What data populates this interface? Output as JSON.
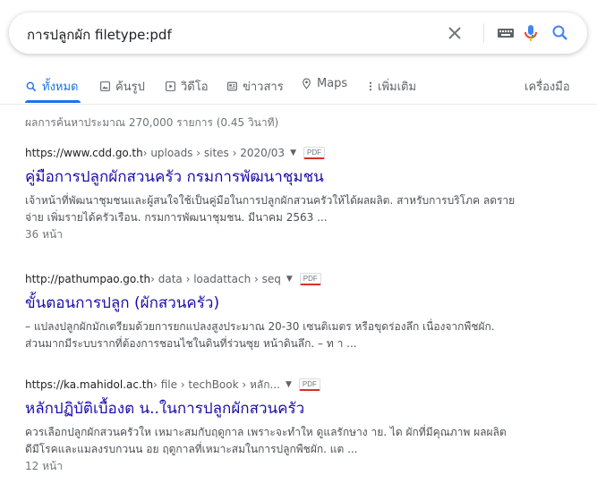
{
  "search": {
    "query": "การปลูกผัก filetype:pdf"
  },
  "icons": {
    "clear": "close-icon",
    "keyboard": "keyboard-icon",
    "mic": "microphone-icon",
    "search": "search-icon"
  },
  "colors": {
    "accent": "#1a73e8",
    "link": "#1a0dab",
    "pdf_underline": "#d93025"
  },
  "tabs": [
    {
      "label": "ทั้งหมด",
      "icon": "search-icon",
      "active": true
    },
    {
      "label": "ค้นรูป",
      "icon": "image-icon"
    },
    {
      "label": "วิดีโอ",
      "icon": "video-icon"
    },
    {
      "label": "ข่าวสาร",
      "icon": "news-icon"
    },
    {
      "label": "Maps",
      "icon": "map-pin-icon"
    },
    {
      "label": "เพิ่มเติม",
      "icon": "more-vert-icon"
    }
  ],
  "tools_label": "เครื่องมือ",
  "stats": "ผลการค้นหาประมาณ 270,000 รายการ (0.45 วินาที)",
  "results": [
    {
      "url": "https://www.cdd.go.th",
      "breadcrumb": " › uploads › sites › 2020/03",
      "badge": "PDF",
      "title": "คู่มือการปลูกผักสวนครัว กรมการพัฒนาชุมชน",
      "snippet_line1": "เจ้าหน้าที่พัฒนาชุมชนและผู้สนใจใช้เป็นคู่มือในการปลูกผักสวนครัวให้ได้ผลผลิต. สาหรับการบริโภค ลดราย",
      "snippet_line2": "จ่าย เพิ่มรายได้ครัวเรือน. กรมการพัฒนาชุมชน. มีนาคม 2563 ...",
      "pages": "36 หน้า"
    },
    {
      "url": "http://pathumpao.go.th",
      "breadcrumb": " › data › loadattach › seq",
      "badge": "PDF",
      "title": "ขั้นตอนการปลูก (ผักสวนครัว)",
      "snippet_line1": "– แปลงปลูกผักมักเตรียมด้วยการยกแปลงสูงประมาณ 20-30 เซนติเมตร หรือขุดร่องลึก เนื่องจากพืชผัก.",
      "snippet_line2": "ส่วนมากมีระบบรากที่ต้องการชอนไชในดินที่ร่วนซุย หน้าดินลึก. – ท า ...",
      "pages": ""
    },
    {
      "url": "https://ka.mahidol.ac.th",
      "breadcrumb": " › file › techBook › หลัก...",
      "badge": "PDF",
      "title": "หลักปฏิบัติเบื้องต น..ในการปลูกผักสวนครัว",
      "snippet_line1": "ควรเลือกปลูกผักสวนครัวให เหมาะสมกับฤดูกาล เพราะจะทำให ดูแลรักษาง าย. ได ผักที่มีคุณภาพ ผลผลิต",
      "snippet_line2": "ดีมีโรคและแมลงรบกวนน อย ฤดูกาลที่เหมาะสมในการปลูกพืชผัก. แต ...",
      "pages": "12 หน้า"
    }
  ]
}
